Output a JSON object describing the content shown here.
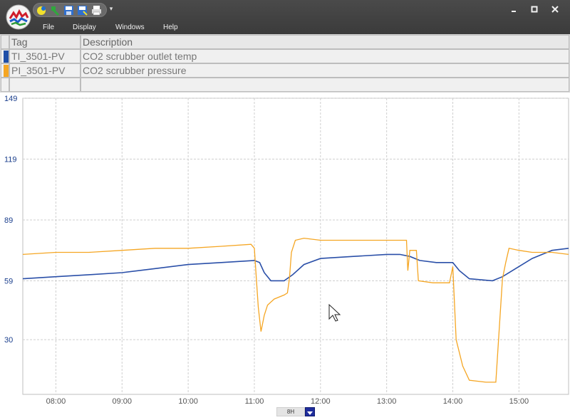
{
  "menu": {
    "file": "File",
    "display": "Display",
    "windows": "Windows",
    "help": "Help"
  },
  "quick_access": [
    {
      "icon": "open-trend-icon"
    },
    {
      "icon": "edit-icon"
    },
    {
      "icon": "save-icon"
    },
    {
      "icon": "save-as-icon"
    },
    {
      "icon": "print-icon"
    }
  ],
  "window_controls": {
    "minimize": "minimize-icon",
    "maximize": "maximize-icon",
    "close": "close-icon"
  },
  "tag_table": {
    "headers": {
      "tag": "Tag",
      "description": "Description"
    },
    "rows": [
      {
        "tag": "TI_3501-PV",
        "description": "CO2 scrubber outlet temp",
        "color": "#1f4fa8"
      },
      {
        "tag": "PI_3501-PV",
        "description": "CO2 scrubber pressure",
        "color": "#f5a623"
      },
      {
        "tag": "",
        "description": "",
        "color": ""
      }
    ]
  },
  "time_range": {
    "value": "8H"
  },
  "chart_data": {
    "type": "line",
    "y_axis": {
      "ticks": [
        30,
        59,
        89,
        119,
        149
      ],
      "range": [
        3,
        149
      ],
      "tick_color": "#1a3e8c"
    },
    "x_axis": {
      "ticks": [
        "08:00",
        "09:00",
        "10:00",
        "11:00",
        "12:00",
        "13:00",
        "14:00",
        "15:00"
      ],
      "range_hours": [
        7.5,
        15.75
      ]
    },
    "grid": true,
    "series": [
      {
        "tag": "TI_3501-PV",
        "color": "#2a4fa8",
        "points": [
          [
            7.5,
            60
          ],
          [
            8.0,
            61
          ],
          [
            8.5,
            62
          ],
          [
            9.0,
            63
          ],
          [
            9.5,
            65
          ],
          [
            10.0,
            67
          ],
          [
            10.5,
            68
          ],
          [
            11.0,
            69
          ],
          [
            11.08,
            68
          ],
          [
            11.15,
            63
          ],
          [
            11.25,
            59
          ],
          [
            11.45,
            59
          ],
          [
            11.58,
            62
          ],
          [
            11.75,
            67
          ],
          [
            12.0,
            70
          ],
          [
            12.5,
            71
          ],
          [
            13.0,
            72
          ],
          [
            13.2,
            72
          ],
          [
            13.35,
            71
          ],
          [
            13.5,
            69
          ],
          [
            13.75,
            68
          ],
          [
            14.0,
            68
          ],
          [
            14.1,
            64
          ],
          [
            14.25,
            60
          ],
          [
            14.6,
            59
          ],
          [
            14.75,
            61
          ],
          [
            14.95,
            65
          ],
          [
            15.2,
            70
          ],
          [
            15.5,
            74
          ],
          [
            15.75,
            75
          ]
        ]
      },
      {
        "tag": "PI_3501-PV",
        "color": "#f5a623",
        "points": [
          [
            7.5,
            72
          ],
          [
            8.0,
            73
          ],
          [
            8.5,
            73
          ],
          [
            9.0,
            74
          ],
          [
            9.5,
            75
          ],
          [
            10.0,
            75
          ],
          [
            10.5,
            76
          ],
          [
            10.95,
            77
          ],
          [
            11.0,
            75
          ],
          [
            11.03,
            60
          ],
          [
            11.06,
            46
          ],
          [
            11.1,
            34
          ],
          [
            11.15,
            42
          ],
          [
            11.2,
            47
          ],
          [
            11.3,
            50
          ],
          [
            11.45,
            52
          ],
          [
            11.5,
            53
          ],
          [
            11.53,
            60
          ],
          [
            11.56,
            73
          ],
          [
            11.62,
            79
          ],
          [
            11.75,
            80
          ],
          [
            12.0,
            79
          ],
          [
            12.5,
            79
          ],
          [
            13.0,
            79
          ],
          [
            13.3,
            79
          ],
          [
            13.32,
            64
          ],
          [
            13.35,
            74
          ],
          [
            13.45,
            74
          ],
          [
            13.48,
            59
          ],
          [
            13.7,
            58
          ],
          [
            13.95,
            58
          ],
          [
            14.0,
            66
          ],
          [
            14.05,
            30
          ],
          [
            14.15,
            17
          ],
          [
            14.25,
            10
          ],
          [
            14.5,
            9
          ],
          [
            14.65,
            9
          ],
          [
            14.75,
            60
          ],
          [
            14.8,
            68
          ],
          [
            14.85,
            75
          ],
          [
            15.0,
            74
          ],
          [
            15.2,
            73
          ],
          [
            15.5,
            73
          ],
          [
            15.75,
            72
          ]
        ]
      }
    ]
  }
}
